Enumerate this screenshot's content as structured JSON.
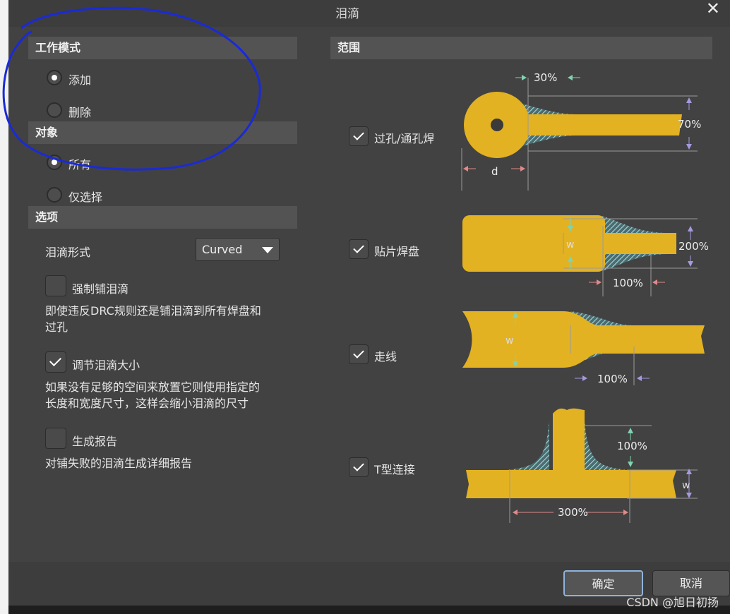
{
  "dialog": {
    "title": "泪滴"
  },
  "left": {
    "mode": {
      "header": "工作模式",
      "options": [
        "添加",
        "删除"
      ],
      "selected": 0
    },
    "object": {
      "header": "对象",
      "options": [
        "所有",
        "仅选择"
      ],
      "selected": 0
    },
    "options": {
      "header": "选项",
      "style_label": "泪滴形式",
      "style_value": "Curved",
      "force": {
        "label": "强制铺泪滴",
        "checked": false,
        "desc1": "即使违反DRC规则还是铺泪滴到所有焊盘和",
        "desc2": "过孔"
      },
      "adjust": {
        "label": "调节泪滴大小",
        "checked": true,
        "desc1": "如果没有足够的空间来放置它则使用指定的",
        "desc2": "长度和宽度尺寸，这样会缩小泪滴的尺寸"
      },
      "report": {
        "label": "生成报告",
        "checked": false,
        "desc1": "对铺失败的泪滴生成详细报告"
      }
    }
  },
  "right": {
    "header": "范围",
    "items": [
      {
        "label": "过孔/通孔焊",
        "checked": true
      },
      {
        "label": "贴片焊盘",
        "checked": true
      },
      {
        "label": "走线",
        "checked": true
      },
      {
        "label": "T型连接",
        "checked": true
      }
    ],
    "via": {
      "top_pct": "30%",
      "side_pct": "70%",
      "d": "d"
    },
    "smd": {
      "w": "w",
      "side_pct": "200%",
      "bottom_pct": "100%"
    },
    "track": {
      "w": "w",
      "bottom_pct": "100%"
    },
    "tee": {
      "side_pct": "100%",
      "w": "w",
      "bottom_pct": "300%"
    }
  },
  "footer": {
    "ok": "确定",
    "cancel": "取消"
  },
  "watermark": "CSDN @旭日初扬",
  "colors": {
    "copper": "#e3b222",
    "hatch": "#9fe7ee"
  }
}
